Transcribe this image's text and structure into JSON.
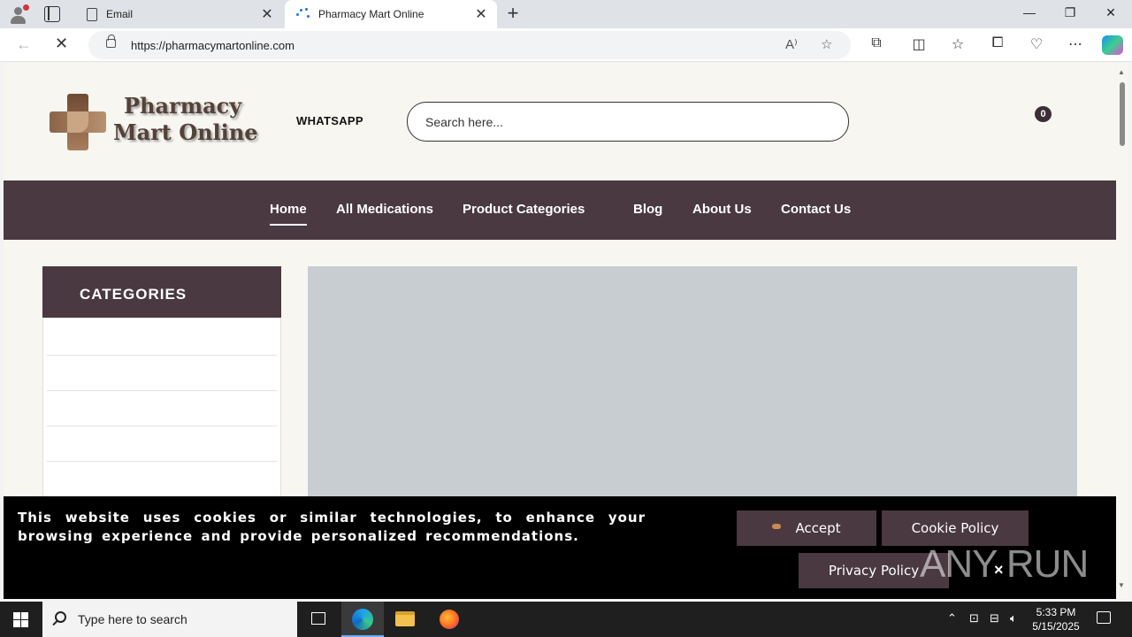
{
  "browser": {
    "tabs": [
      {
        "label": "Email"
      },
      {
        "label": "Pharmacy Mart Online"
      }
    ],
    "url": "https://pharmacymartonline.com"
  },
  "site": {
    "logo_line1": "Pharmacy",
    "logo_line2": "Mart Online",
    "whatsapp_label": "WHATSAPP",
    "search_placeholder": "Search here...",
    "cart_count": "0",
    "brand_color": "#4a3941",
    "nav": [
      {
        "label": "Home",
        "active": true
      },
      {
        "label": "All Medications"
      },
      {
        "label": "Product Categories"
      },
      {
        "label": "Blog"
      },
      {
        "label": "About Us"
      },
      {
        "label": "Contact Us"
      }
    ],
    "categories_title": "CATEGORIES"
  },
  "cookie": {
    "message": "This website uses cookies or similar technologies, to enhance your browsing experience and provide personalized recommendations.",
    "accept_label": "Accept",
    "cookie_policy_label": "Cookie Policy",
    "privacy_policy_label": "Privacy Policy",
    "close_label": "×"
  },
  "watermark": "ANY RUN",
  "taskbar": {
    "search_placeholder": "Type here to search",
    "time": "5:33 PM",
    "date": "5/15/2025"
  }
}
